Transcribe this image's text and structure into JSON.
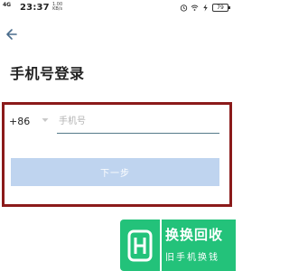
{
  "status_bar": {
    "signal": "4G",
    "time": "23:37",
    "net_speed_value": "1.00",
    "net_speed_unit": "KB/s",
    "battery": "79"
  },
  "header": {
    "title": "手机号登录"
  },
  "login_form": {
    "country_code": "+86",
    "phone_placeholder": "手机号",
    "phone_value": "",
    "next_label": "下一步"
  },
  "watermark": {
    "title": "换换回收",
    "subtitle": "旧手机换钱"
  },
  "colors": {
    "highlight_frame": "#8b1a1a",
    "next_button_bg": "#bfd4ef",
    "input_underline": "#557a8a",
    "watermark_green": "#23c27a"
  }
}
